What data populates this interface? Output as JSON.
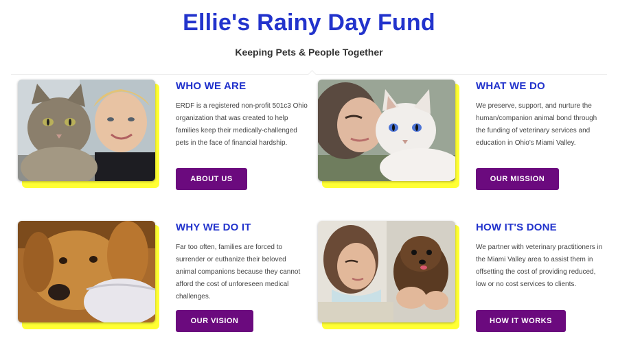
{
  "header": {
    "title": "Ellie's Rainy Day Fund",
    "subtitle": "Keeping Pets & People Together"
  },
  "colors": {
    "heading_blue": "#2233cc",
    "button_purple": "#6b0a7e",
    "photo_accent_yellow": "#ffff33"
  },
  "cards": [
    {
      "heading": "WHO WE ARE",
      "body": "ERDF is a registered non-profit 501c3 Ohio organization that was created to help families keep their medically-challenged pets in the face of financial hardship.",
      "button": "ABOUT US",
      "image": "Tabby cat next to a smiling blond boy"
    },
    {
      "heading": "WHAT WE DO",
      "body": "We preserve, support, and nurture the human/companion animal bond through the funding of veterinary services and education in Ohio's Miami Valley.",
      "button": "OUR MISSION",
      "image": "Woman cuddling a white blue-eyed cat"
    },
    {
      "heading": "WHY WE DO IT",
      "body": "Far too often, families are forced to surrender or euthanize their beloved animal companions because they cannot afford the cost of unforeseen medical challenges.",
      "button": "OUR VISION",
      "image": "Golden retriever resting its head on a pillow"
    },
    {
      "heading": "HOW IT'S DONE",
      "body": "We partner with veterinary practitioners in the Miami Valley area to assist them in offsetting the cost of providing reduced, low or no cost services to clients.",
      "button": "HOW IT WORKS",
      "image": "Woman holding a small brown fluffy puppy"
    }
  ]
}
